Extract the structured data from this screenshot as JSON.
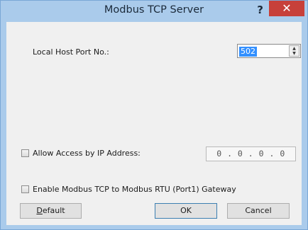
{
  "window": {
    "title": "Modbus TCP Server",
    "help_glyph": "?",
    "close_glyph": "✕"
  },
  "port": {
    "label": "Local Host Port No.:",
    "value": "502"
  },
  "allow_access": {
    "label": "Allow Access by IP Address:",
    "checked": false,
    "ip": "0 . 0 . 0 . 0"
  },
  "gateway": {
    "label": "Enable Modbus TCP to Modbus RTU (Port1) Gateway",
    "checked": false
  },
  "buttons": {
    "default_first": "D",
    "default_rest": "efault",
    "ok": "OK",
    "cancel": "Cancel"
  }
}
